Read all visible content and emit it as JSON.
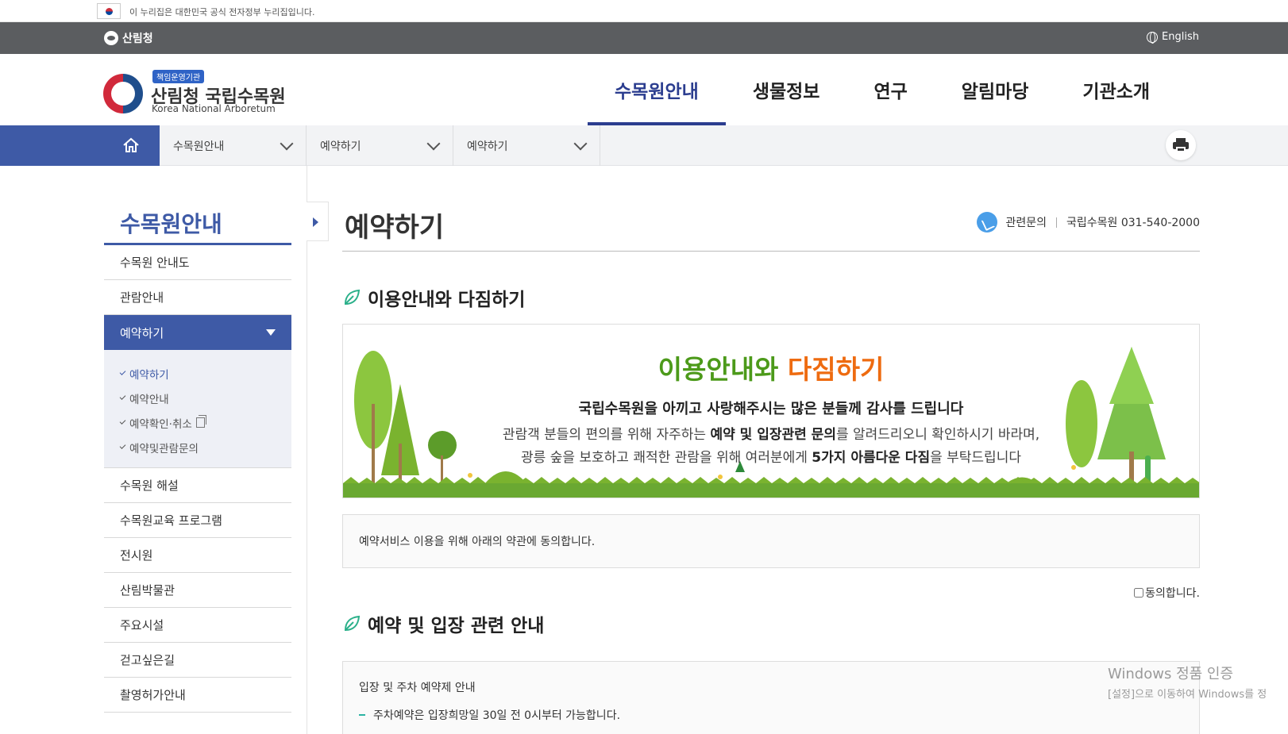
{
  "gov_banner": {
    "text": "이 누리집은 대한민국 공식 전자정부 누리집입니다."
  },
  "util_bar": {
    "logo_text": "산림청",
    "lang_label": "English"
  },
  "header": {
    "badge": "책임운영기관",
    "title": "산림청 국립수목원",
    "subtitle": "Korea National Arboretum",
    "nav": [
      "수목원안내",
      "생물정보",
      "연구",
      "알림마당",
      "기관소개"
    ],
    "active_nav": "수목원안내"
  },
  "location": {
    "level1": "수목원안내",
    "level2": "예약하기",
    "level3": "예약하기"
  },
  "sidebar": {
    "title": "수목원안내",
    "items": [
      "수목원 안내도",
      "관람안내",
      "예약하기",
      "수목원 해설",
      "수목원교육 프로그램",
      "전시원",
      "산림박물관",
      "주요시설",
      "걷고싶은길",
      "촬영허가안내"
    ],
    "active": "예약하기",
    "sub_items": [
      "예약하기",
      "예약안내",
      "예약확인·취소",
      "예약및관람문의"
    ]
  },
  "content": {
    "page_title": "예약하기",
    "contact_label": "관련문의",
    "contact_value": "국립수목원 031-540-2000",
    "section1_title": "이용안내와 다짐하기",
    "banner": {
      "head_green": "이용안내와",
      "head_orange": "다짐하기",
      "line1": "국립수목원을 아끼고 사랑해주시는 많은 분들께 감사를 드립니다",
      "line2_a": "관람객 분들의 편의를 위해 자주하는 ",
      "line2_b": "예약 및 입장관련 문의",
      "line2_c": "를 알려드리오니 확인하시기 바라며,",
      "line3_a": "광릉 숲을 보호하고 쾌적한 관람을 위해 여러분에게 ",
      "line3_b": "5가지 아름다운 다짐",
      "line3_c": "을 부탁드립니다"
    },
    "agree_text": "예약서비스 이용을 위해 아래의 약관에 동의합니다.",
    "agree_checkbox": "동의합니다.",
    "section2_title": "예약 및 입장 관련 안내",
    "info_head": "입장 및 주차 예약제 안내",
    "info_item1": "주차예약은 입장희망일 30일 전 0시부터 가능합니다."
  },
  "watermark": {
    "line1": "Windows 정품 인증",
    "line2": "[설정]으로 이동하여 Windows를 정"
  },
  "colors": {
    "primary": "#3e5aa6",
    "nav_active": "#2b3d8f",
    "banner_green": "#4c9a1a",
    "banner_orange": "#ee6b10"
  }
}
